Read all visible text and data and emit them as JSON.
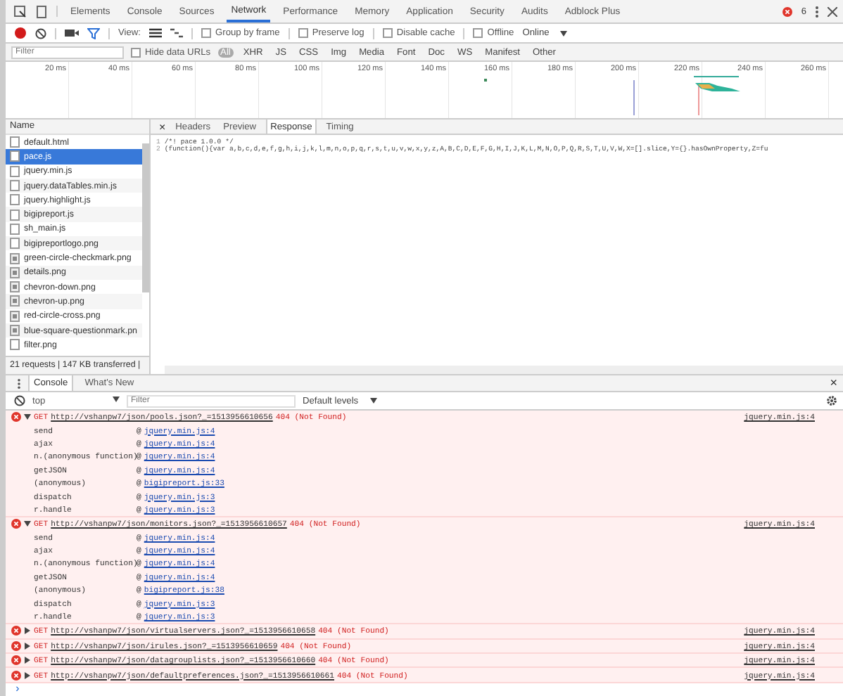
{
  "tabs": [
    {
      "label": "Elements",
      "selected": false
    },
    {
      "label": "Console",
      "selected": false
    },
    {
      "label": "Sources",
      "selected": false
    },
    {
      "label": "Network",
      "selected": true
    },
    {
      "label": "Performance",
      "selected": false
    },
    {
      "label": "Memory",
      "selected": false
    },
    {
      "label": "Application",
      "selected": false
    },
    {
      "label": "Security",
      "selected": false
    },
    {
      "label": "Audits",
      "selected": false
    },
    {
      "label": "Adblock Plus",
      "selected": false
    }
  ],
  "error_count": "6",
  "toolbar": {
    "recording": true,
    "view_label": "View:",
    "options": [
      {
        "label": "Group by frame",
        "checked": false
      },
      {
        "label": "Preserve log",
        "checked": false
      },
      {
        "label": "Disable cache",
        "checked": false
      },
      {
        "label": "Offline",
        "checked": false
      }
    ],
    "throttling": "Online"
  },
  "filter_bar": {
    "placeholder": "Filter",
    "hide_data_urls": {
      "label": "Hide data URLs",
      "checked": false
    },
    "types": [
      {
        "label": "All",
        "selected": true
      },
      {
        "label": "XHR",
        "selected": false
      },
      {
        "label": "JS",
        "selected": false
      },
      {
        "label": "CSS",
        "selected": false
      },
      {
        "label": "Img",
        "selected": false
      },
      {
        "label": "Media",
        "selected": false
      },
      {
        "label": "Font",
        "selected": false
      },
      {
        "label": "Doc",
        "selected": false
      },
      {
        "label": "WS",
        "selected": false
      },
      {
        "label": "Manifest",
        "selected": false
      },
      {
        "label": "Other",
        "selected": false
      }
    ]
  },
  "timeline": {
    "ticks": [
      "20 ms",
      "40 ms",
      "60 ms",
      "80 ms",
      "100 ms",
      "120 ms",
      "140 ms",
      "160 ms",
      "180 ms",
      "200 ms",
      "220 ms",
      "240 ms",
      "260 ms"
    ]
  },
  "requests": {
    "column": "Name",
    "items": [
      {
        "name": "default.html",
        "kind": "doc",
        "selected": false
      },
      {
        "name": "pace.js",
        "kind": "doc",
        "selected": true
      },
      {
        "name": "jquery.min.js",
        "kind": "doc",
        "selected": false
      },
      {
        "name": "jquery.dataTables.min.js",
        "kind": "doc",
        "selected": false
      },
      {
        "name": "jquery.highlight.js",
        "kind": "doc",
        "selected": false
      },
      {
        "name": "bigipreport.js",
        "kind": "doc",
        "selected": false
      },
      {
        "name": "sh_main.js",
        "kind": "doc",
        "selected": false
      },
      {
        "name": "bigipreportlogo.png",
        "kind": "doc",
        "selected": false
      },
      {
        "name": "green-circle-checkmark.png",
        "kind": "image",
        "selected": false
      },
      {
        "name": "details.png",
        "kind": "image",
        "selected": false
      },
      {
        "name": "chevron-down.png",
        "kind": "image",
        "selected": false
      },
      {
        "name": "chevron-up.png",
        "kind": "image",
        "selected": false
      },
      {
        "name": "red-circle-cross.png",
        "kind": "image",
        "selected": false
      },
      {
        "name": "blue-square-questionmark.pn",
        "kind": "image",
        "selected": false
      },
      {
        "name": "filter.png",
        "kind": "doc",
        "selected": false
      }
    ],
    "summary": "21 requests | 147 KB transferred |"
  },
  "detail": {
    "close": "×",
    "tabs": [
      {
        "label": "Headers",
        "selected": false
      },
      {
        "label": "Preview",
        "selected": false
      },
      {
        "label": "Response",
        "selected": true
      },
      {
        "label": "Timing",
        "selected": false
      }
    ],
    "lines": [
      {
        "number": "1",
        "text": "/*! pace 1.0.0 */"
      },
      {
        "number": "2",
        "text": "(function(){var a,b,c,d,e,f,g,h,i,j,k,l,m,n,o,p,q,r,s,t,u,v,w,x,y,z,A,B,C,D,E,F,G,H,I,J,K,L,M,N,O,P,Q,R,S,T,U,V,W,X=[].slice,Y={}.hasOwnProperty,Z=fu"
      }
    ]
  },
  "drawer": {
    "tabs": [
      {
        "label": "Console",
        "selected": true
      },
      {
        "label": "What's New",
        "selected": false
      }
    ],
    "close": "×",
    "context": "top",
    "filter_placeholder": "Filter",
    "levels": "Default levels"
  },
  "messages": [
    {
      "method": "GET",
      "url": "http://vshanpw7/json/pools.json?_=1513956610656",
      "status": "404 (Not Found)",
      "source": "jquery.min.js:4",
      "expanded": true,
      "frames": [
        {
          "fn": "send",
          "at": "@",
          "loc": "jquery.min.js:4"
        },
        {
          "fn": "ajax",
          "at": "@",
          "loc": "jquery.min.js:4"
        },
        {
          "fn": "n.(anonymous function)",
          "at": "@",
          "loc": "jquery.min.js:4"
        },
        {
          "fn": "getJSON",
          "at": "@",
          "loc": "jquery.min.js:4"
        },
        {
          "fn": "(anonymous)",
          "at": "@",
          "loc": "bigipreport.js:33"
        },
        {
          "fn": "dispatch",
          "at": "@",
          "loc": "jquery.min.js:3"
        },
        {
          "fn": "r.handle",
          "at": "@",
          "loc": "jquery.min.js:3"
        }
      ]
    },
    {
      "method": "GET",
      "url": "http://vshanpw7/json/monitors.json?_=1513956610657",
      "status": "404 (Not Found)",
      "source": "jquery.min.js:4",
      "expanded": true,
      "frames": [
        {
          "fn": "send",
          "at": "@",
          "loc": "jquery.min.js:4"
        },
        {
          "fn": "ajax",
          "at": "@",
          "loc": "jquery.min.js:4"
        },
        {
          "fn": "n.(anonymous function)",
          "at": "@",
          "loc": "jquery.min.js:4"
        },
        {
          "fn": "getJSON",
          "at": "@",
          "loc": "jquery.min.js:4"
        },
        {
          "fn": "(anonymous)",
          "at": "@",
          "loc": "bigipreport.js:38"
        },
        {
          "fn": "dispatch",
          "at": "@",
          "loc": "jquery.min.js:3"
        },
        {
          "fn": "r.handle",
          "at": "@",
          "loc": "jquery.min.js:3"
        }
      ]
    },
    {
      "method": "GET",
      "url": "http://vshanpw7/json/virtualservers.json?_=1513956610658",
      "status": "404 (Not Found)",
      "source": "jquery.min.js:4",
      "expanded": false
    },
    {
      "method": "GET",
      "url": "http://vshanpw7/json/irules.json?_=1513956610659",
      "status": "404 (Not Found)",
      "source": "jquery.min.js:4",
      "expanded": false
    },
    {
      "method": "GET",
      "url": "http://vshanpw7/json/datagrouplists.json?_=1513956610660",
      "status": "404 (Not Found)",
      "source": "jquery.min.js:4",
      "expanded": false
    },
    {
      "method": "GET",
      "url": "http://vshanpw7/json/defaultpreferences.json?_=1513956610661",
      "status": "404 (Not Found)",
      "source": "jquery.min.js:4",
      "expanded": false
    }
  ],
  "prompt": "›"
}
